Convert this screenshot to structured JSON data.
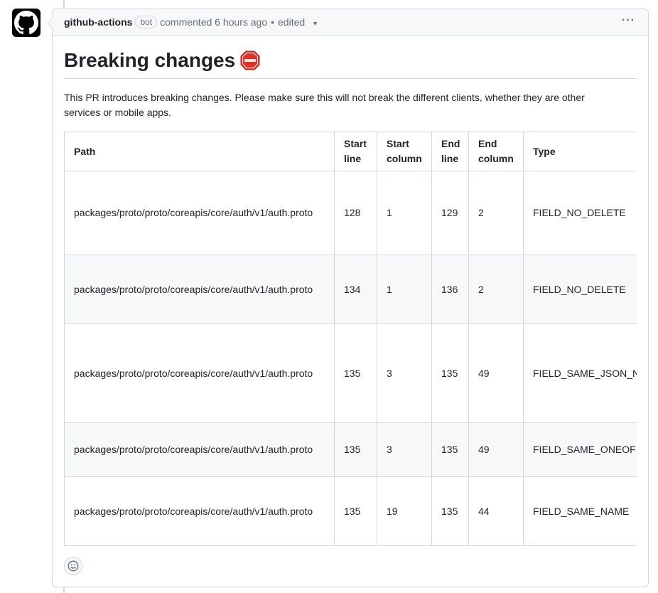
{
  "comment": {
    "author": "github-actions",
    "badge": "bot",
    "action": "commented 6 hours ago",
    "separator": "•",
    "edited": "edited",
    "menu": "···"
  },
  "body": {
    "title": "Breaking changes",
    "title_emoji_icon": "stop-sign-icon",
    "intro": "This PR introduces breaking changes. Please make sure this will not break the different clients, whether they are other services or mobile apps."
  },
  "table": {
    "headers": [
      "Path",
      "Start line",
      "Start column",
      "End line",
      "End column",
      "Type"
    ],
    "rows": [
      [
        "packages/proto/proto/coreapis/core/auth/v1/auth.proto",
        "128",
        "1",
        "129",
        "2",
        "FIELD_NO_DELETE"
      ],
      [
        "packages/proto/proto/coreapis/core/auth/v1/auth.proto",
        "134",
        "1",
        "136",
        "2",
        "FIELD_NO_DELETE"
      ],
      [
        "packages/proto/proto/coreapis/core/auth/v1/auth.proto",
        "135",
        "3",
        "135",
        "49",
        "FIELD_SAME_JSON_N"
      ],
      [
        "packages/proto/proto/coreapis/core/auth/v1/auth.proto",
        "135",
        "3",
        "135",
        "49",
        "FIELD_SAME_ONEOF"
      ],
      [
        "packages/proto/proto/coreapis/core/auth/v1/auth.proto",
        "135",
        "19",
        "135",
        "44",
        "FIELD_SAME_NAME"
      ]
    ]
  },
  "colors": {
    "border": "#d0d7de",
    "header_bg": "#f6f8fa",
    "text": "#1f2328",
    "muted": "#656d76",
    "stop_sign": "#e0312b"
  }
}
